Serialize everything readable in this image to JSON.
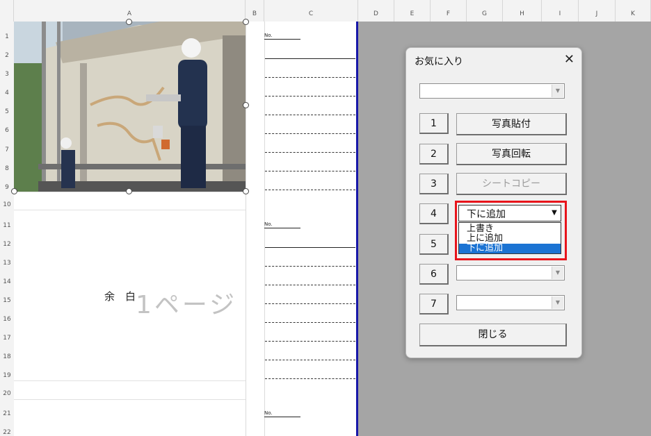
{
  "columns": [
    "A",
    "B",
    "C",
    "D",
    "E",
    "F",
    "G",
    "H",
    "I",
    "J",
    "K"
  ],
  "rows": [
    "1",
    "2",
    "3",
    "4",
    "5",
    "6",
    "7",
    "8",
    "9",
    "10",
    "11",
    "12",
    "13",
    "14",
    "15",
    "16",
    "17",
    "18",
    "19",
    "20",
    "21",
    "22"
  ],
  "sheet": {
    "no_label": "No.",
    "margin_text": "余　白",
    "page_watermark": "1ページ"
  },
  "dialog": {
    "title": "お気に入り",
    "close_icon": "close-icon",
    "top_combo_value": "",
    "buttons": [
      {
        "num": "1",
        "label": "写真貼付",
        "enabled": true
      },
      {
        "num": "2",
        "label": "写真回転",
        "enabled": true
      },
      {
        "num": "3",
        "label": "シートコピー",
        "enabled": false
      }
    ],
    "row4": {
      "num": "4",
      "value": "下に追加"
    },
    "row5": {
      "num": "5"
    },
    "row6": {
      "num": "6",
      "value": ""
    },
    "row7": {
      "num": "7",
      "value": ""
    },
    "close_button": "閉じる",
    "dropdown_options": [
      "上書き",
      "上に追加",
      "下に追加"
    ],
    "dropdown_selected": "下に追加"
  },
  "colors": {
    "page_break": "#1717a8",
    "highlight": "#e8141b",
    "selected": "#1b73d3"
  }
}
